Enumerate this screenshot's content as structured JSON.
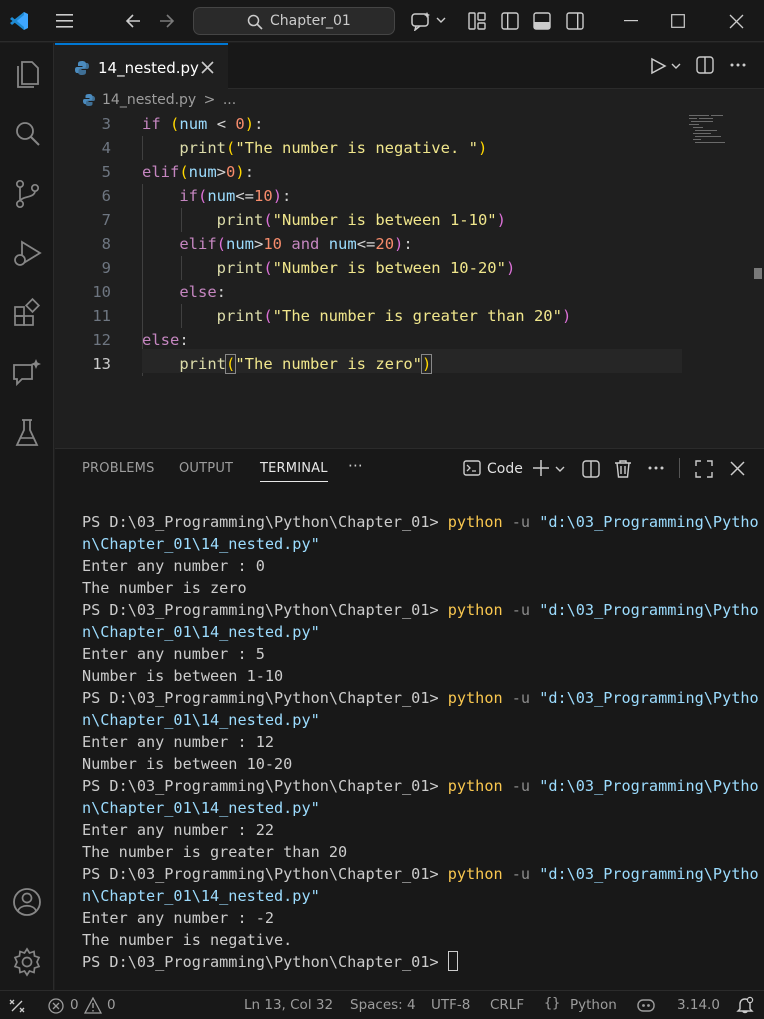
{
  "titlebar": {
    "search_label": "Chapter_01",
    "icons": [
      "vscode-logo-icon",
      "menu-icon",
      "back-arrow-icon",
      "forward-arrow-icon",
      "search-icon",
      "copilot-icon",
      "chevron-down-icon",
      "layout-icon",
      "toggle-sidebar-icon",
      "toggle-panel-icon",
      "toggle-secondary-sidebar-icon",
      "minimize-icon",
      "maximize-icon",
      "close-icon"
    ]
  },
  "activity_bar": [
    "explorer-icon",
    "search-icon",
    "source-control-icon",
    "run-debug-icon",
    "extensions-icon",
    "chat-icon",
    "testing-icon",
    "account-icon",
    "settings-gear-icon"
  ],
  "tab": {
    "filename": "14_nested.py"
  },
  "breadcrumb": {
    "file": "14_nested.py",
    "sep": ">",
    "more": "..."
  },
  "editor": {
    "line_numbers": [
      "3",
      "4",
      "5",
      "6",
      "7",
      "8",
      "9",
      "10",
      "11",
      "12",
      "13"
    ],
    "active_line": "13"
  },
  "panel": {
    "tabs": [
      "PROBLEMS",
      "OUTPUT",
      "TERMINAL"
    ],
    "more": "···",
    "code_label": "Code"
  },
  "terminal": {
    "prompt": "PS D:\\03_Programming\\Python\\Chapter_01> ",
    "cmd": "python",
    "flag": " -u ",
    "path_a": "\"d:\\03_Programming\\Pytho",
    "path_b": "n\\Chapter_01\\14_nested.py\"",
    "runs": [
      {
        "input": "Enter any number : 0",
        "output": "The number is zero"
      },
      {
        "input": "Enter any number : 5",
        "output": "Number is between 1-10"
      },
      {
        "input": "Enter any number : 12",
        "output": "Number is between 10-20"
      },
      {
        "input": "Enter any number : 22",
        "output": "The number is greater than 20"
      },
      {
        "input": "Enter any number : -2",
        "output": "The number is negative."
      }
    ],
    "final_prompt": "PS D:\\03_Programming\\Python\\Chapter_01> "
  },
  "statusbar": {
    "errors": "0",
    "warnings": "0",
    "position": "Ln 13, Col 32",
    "spaces": "Spaces: 4",
    "encoding": "UTF-8",
    "eol": "CRLF",
    "language": "Python",
    "interpreter": "3.14.0"
  }
}
